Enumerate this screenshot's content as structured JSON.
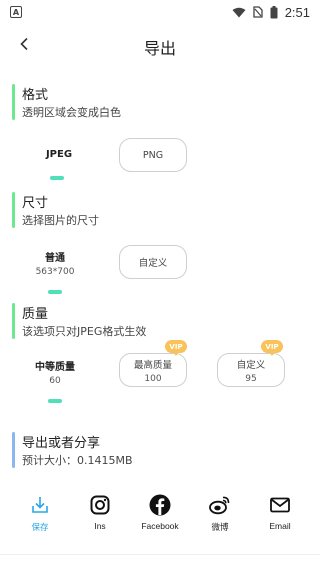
{
  "status": {
    "time": "2:51"
  },
  "header": {
    "title": "导出"
  },
  "format": {
    "title": "格式",
    "desc": "透明区域会变成白色",
    "options": [
      "JPEG",
      "PNG"
    ]
  },
  "size": {
    "title": "尺寸",
    "desc": "选择图片的尺寸",
    "normal_label": "普通",
    "normal_sub": "563*700",
    "custom_label": "自定义"
  },
  "quality": {
    "title": "质量",
    "desc": "该选项只对JPEG格式生效",
    "medium_label": "中等质量",
    "medium_value": "60",
    "highest_label": "最高质量",
    "highest_value": "100",
    "custom_label": "自定义",
    "custom_value": "95",
    "vip": "VIP"
  },
  "export": {
    "title": "导出或者分享",
    "estimate": "预计大小：0.1415MB"
  },
  "share": {
    "items": [
      "保存",
      "Ins",
      "Facebook",
      "微博",
      "Email"
    ]
  },
  "colors": {
    "format_bar": "#6ee88f",
    "size_bar": "#6ee88f",
    "quality_bar": "#6ee88f",
    "export_bar": "#8ab8ee",
    "accent": "#4fe0b9",
    "vip": "#f7c35a",
    "save_active": "#2aa7e6"
  }
}
